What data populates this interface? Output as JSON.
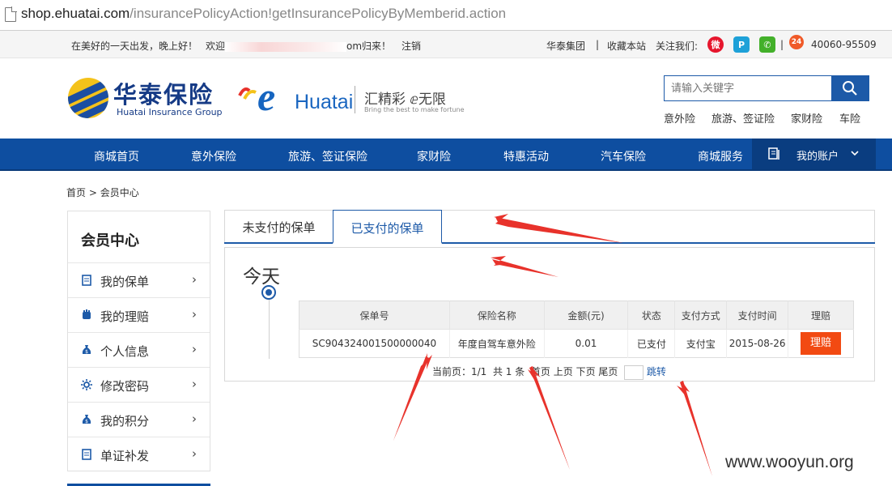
{
  "browser": {
    "url_domain": "shop.ehuatai.com",
    "url_path": "/insurancePolicyAction!getInsurancePolicyByMemberid.action"
  },
  "topbar": {
    "greeting": "在美好的一天出发，晚上好！",
    "welcome_prefix": "欢迎",
    "welcome_suffix": "om归来！",
    "logout": "注销",
    "group": "华泰集团",
    "bookmark": "收藏本站",
    "follow": "关注我们:",
    "hotline": "40060-95509"
  },
  "header": {
    "logo_cn": "华泰保险",
    "logo_en": "Huatai Insurance Group",
    "ehuatai_mark": "e",
    "ehuatai_text": "Huatai",
    "slogan": "汇精彩 ⅇ无限",
    "slogan_en": "Bring the best to make fortune",
    "search_placeholder": "请输入关键字",
    "quick_links": [
      "意外险",
      "旅游、签证险",
      "家财险",
      "车险"
    ]
  },
  "nav": {
    "items": [
      "商城首页",
      "意外保险",
      "旅游、签证保险",
      "家财险",
      "特惠活动",
      "汽车保险",
      "商城服务"
    ],
    "account": "我的账户"
  },
  "breadcrumb": {
    "home": "首页",
    "sep": ">",
    "current": "会员中心"
  },
  "sidebar": {
    "title": "会员中心",
    "items": [
      {
        "label": "我的保单",
        "icon": "document-icon"
      },
      {
        "label": "我的理赔",
        "icon": "hand-icon"
      },
      {
        "label": "个人信息",
        "icon": "money-bag-icon"
      },
      {
        "label": "修改密码",
        "icon": "gear-icon"
      },
      {
        "label": "我的积分",
        "icon": "money-bag-icon"
      },
      {
        "label": "单证补发",
        "icon": "document-icon"
      }
    ]
  },
  "tabs": {
    "unpaid": "未支付的保单",
    "paid": "已支付的保单"
  },
  "content": {
    "day_label": "今天",
    "columns": [
      "保单号",
      "保险名称",
      "金额(元)",
      "状态",
      "支付方式",
      "支付时间",
      "理赔"
    ],
    "rows": [
      {
        "policy_no": "SC904324001500000040",
        "name": "年度自驾车意外险",
        "amount": "0.01",
        "status": "已支付",
        "pay_method": "支付宝",
        "pay_time": "2015-08-26",
        "action": "理赔"
      }
    ],
    "pager": {
      "current_label": "当前页：1/1",
      "total_label": "共 1 条",
      "first": "首页",
      "prev": "上页",
      "next": "下页",
      "last": "尾页",
      "go": "跳转"
    }
  },
  "watermark": "www.wooyun.org",
  "colors": {
    "brand_blue": "#0e4ea0",
    "accent_orange": "#f24a12",
    "annotation_red": "#e8322b"
  }
}
